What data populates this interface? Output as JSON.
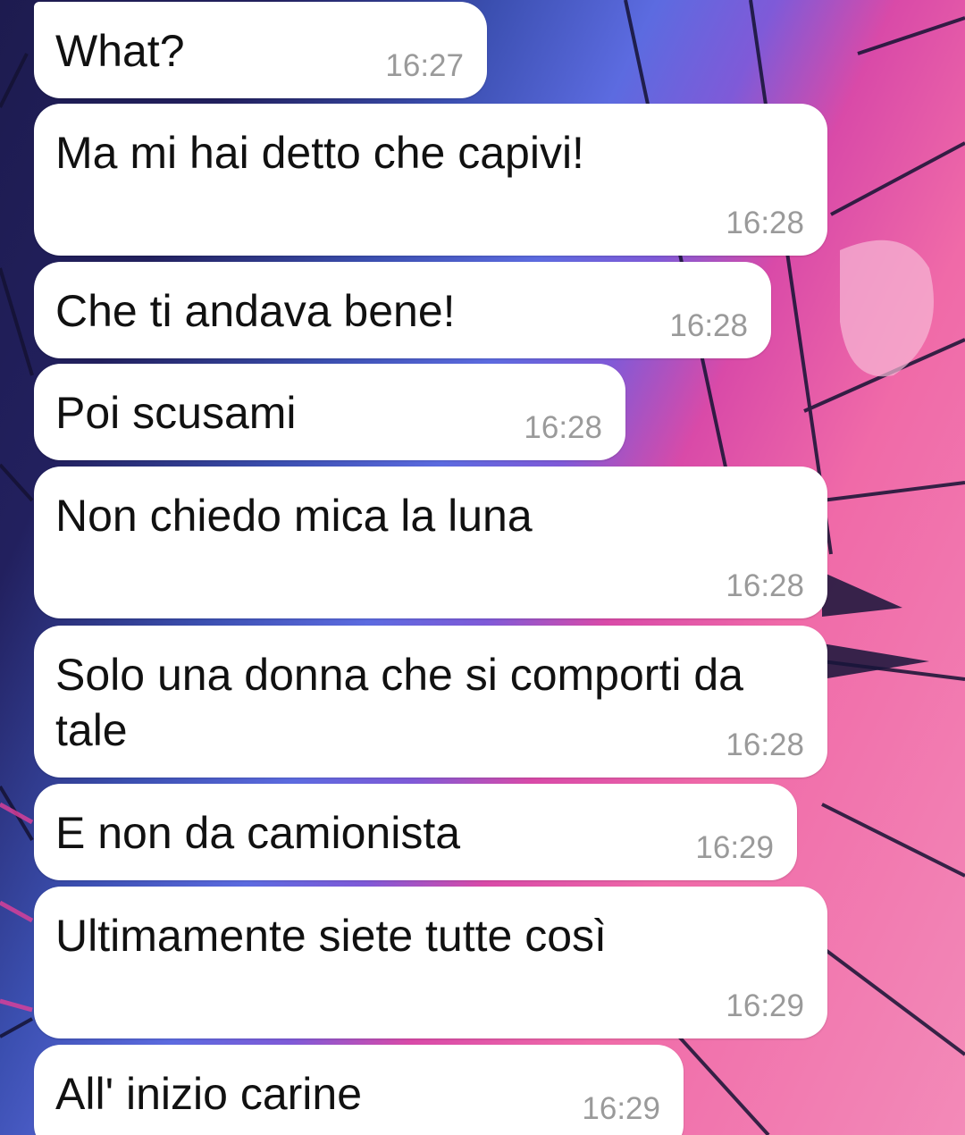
{
  "colors": {
    "bubble": "#ffffff",
    "text": "#111111",
    "timestamp": "#9a9a9a"
  },
  "messages": [
    {
      "text": "What?",
      "time": "16:27"
    },
    {
      "text": "Ma mi hai detto che capivi!",
      "time": "16:28"
    },
    {
      "text": "Che ti andava bene!",
      "time": "16:28"
    },
    {
      "text": "Poi scusami",
      "time": "16:28"
    },
    {
      "text": "Non chiedo mica la luna",
      "time": "16:28"
    },
    {
      "text": "Solo una donna che si comporti da\ntale",
      "time": "16:28"
    },
    {
      "text": "E non da camionista",
      "time": "16:29"
    },
    {
      "text": "Ultimamente siete tutte così",
      "time": "16:29"
    },
    {
      "text": "All' inizio carine",
      "time": "16:29"
    }
  ]
}
